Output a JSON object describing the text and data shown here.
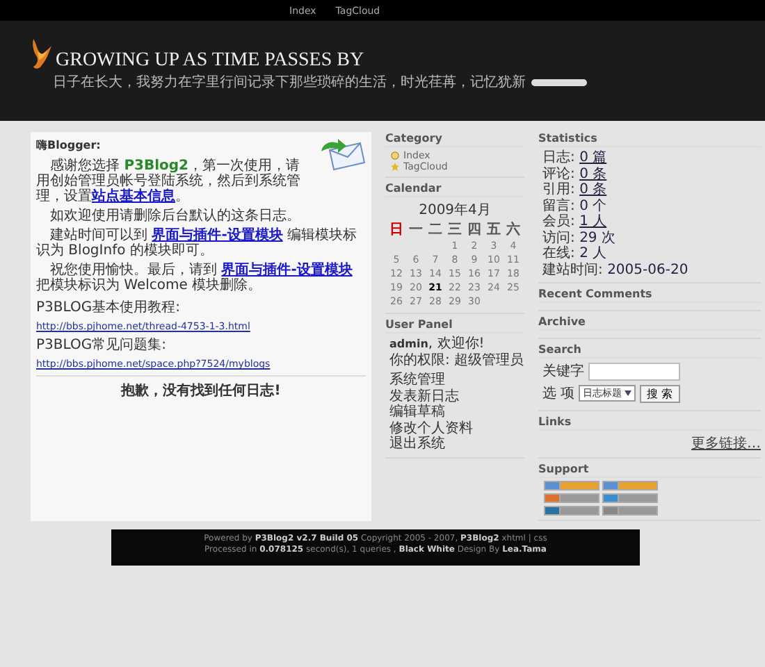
{
  "nav": [
    {
      "label": "Index"
    },
    {
      "label": "TagCloud"
    }
  ],
  "header": {
    "title": "GROWING UP AS TIME PASSES BY",
    "subtitle": "日子在长大，我努力在字里行间记录下那些琐碎的生活，时光荏苒，记忆犹新"
  },
  "welcome": {
    "greeting": "嗨Blogger:",
    "paragraphs": [
      [
        {
          "kind": "text",
          "text": "感谢您选择 "
        },
        {
          "kind": "name",
          "text": "P3Blog2"
        },
        {
          "kind": "text",
          "text": "，第一次使用，请用创始管理员帐号登陆系统，然后到系统管理，设置"
        },
        {
          "kind": "link",
          "text": "站点基本信息"
        },
        {
          "kind": "text",
          "text": "。"
        }
      ],
      [
        {
          "kind": "text",
          "text": "如欢迎使用请删除后台默认的这条日志。"
        }
      ],
      [
        {
          "kind": "text",
          "text": "建站时间可以到 "
        },
        {
          "kind": "link",
          "text": "界面与插件-设置模块"
        },
        {
          "kind": "text",
          "text": " 编辑模块标识为 BlogInfo 的模块即可。"
        }
      ],
      [
        {
          "kind": "text",
          "text": "祝您使用愉快。最后，请到 "
        },
        {
          "kind": "link",
          "text": "界面与插件-设置模块"
        },
        {
          "kind": "text",
          "text": " 把模块标识为 Welcome 模块删除。"
        }
      ]
    ],
    "resources": [
      {
        "label": "P3BLOG基本使用教程:",
        "url": "http://bbs.pjhome.net/thread-4753-1-3.html"
      },
      {
        "label": "P3BLOG常见问题集:",
        "url": "http://bbs.pjhome.net/space.php?7524/myblogs"
      }
    ]
  },
  "notice": "抱歉，没有找到任何日志!",
  "sidebar": [
    {
      "kind": "category",
      "title": "Category",
      "items": [
        "Index",
        "TagCloud"
      ]
    },
    {
      "kind": "calendar",
      "title": "Calendar",
      "month": "2009年4月",
      "weekdays": [
        {
          "label": "日",
          "color": "#cc0000"
        },
        {
          "label": "一",
          "color": "#555555"
        },
        {
          "label": "二",
          "color": "#555555"
        },
        {
          "label": "三",
          "color": "#555555"
        },
        {
          "label": "四",
          "color": "#555555"
        },
        {
          "label": "五",
          "color": "#555555"
        },
        {
          "label": "六",
          "color": "#555555"
        }
      ],
      "weeks": [
        {
          "kind": "tail",
          "days": [
            {
              "day": "1",
              "today": false
            },
            {
              "day": "2",
              "today": false
            },
            {
              "day": "3",
              "today": false
            },
            {
              "day": "4",
              "today": false
            }
          ]
        },
        {
          "kind": "row",
          "days": [
            {
              "day": "5",
              "today": false
            },
            {
              "day": "6",
              "today": false
            },
            {
              "day": "7",
              "today": false
            },
            {
              "day": "8",
              "today": false
            },
            {
              "day": "9",
              "today": false
            },
            {
              "day": "10",
              "today": false
            },
            {
              "day": "11",
              "today": false
            }
          ]
        },
        {
          "kind": "row",
          "days": [
            {
              "day": "12",
              "today": false
            },
            {
              "day": "13",
              "today": false
            },
            {
              "day": "14",
              "today": false
            },
            {
              "day": "15",
              "today": false
            },
            {
              "day": "16",
              "today": false
            },
            {
              "day": "17",
              "today": false
            },
            {
              "day": "18",
              "today": false
            }
          ]
        },
        {
          "kind": "row",
          "days": [
            {
              "day": "19",
              "today": false
            },
            {
              "day": "20",
              "today": false
            },
            {
              "day": "21",
              "today": true
            },
            {
              "day": "22",
              "today": false
            },
            {
              "day": "23",
              "today": false
            },
            {
              "day": "24",
              "today": false
            },
            {
              "day": "25",
              "today": false
            }
          ]
        },
        {
          "kind": "row",
          "days": [
            {
              "day": "26",
              "today": false
            },
            {
              "day": "27",
              "today": false
            },
            {
              "day": "28",
              "today": false
            },
            {
              "day": "29",
              "today": false
            },
            {
              "day": "30",
              "today": false
            }
          ]
        }
      ]
    },
    {
      "kind": "user",
      "title": "User Panel",
      "user": "admin",
      "greeting": ", 欢迎你!",
      "role": "你的权限: 超级管理员",
      "links": [
        "系统管理",
        "发表新日志",
        "编辑草稿",
        "修改个人资料",
        "退出系统"
      ]
    },
    {
      "kind": "stats",
      "title": "Statistics",
      "rows": [
        {
          "label": "日志:",
          "value": "0 篇",
          "link": true
        },
        {
          "label": "评论:",
          "value": "0 条",
          "link": true
        },
        {
          "label": "引用:",
          "value": "0 条",
          "link": true
        },
        {
          "label": "留言:",
          "value": "0 个",
          "link": false
        },
        {
          "label": "会员:",
          "value": "1 人",
          "link": true
        },
        {
          "label": "访问:",
          "value": "29 次",
          "link": false
        },
        {
          "label": "在线:",
          "value": "2 人",
          "link": false
        },
        {
          "label": "建站时间:",
          "value": "2005-06-20",
          "link": false
        }
      ]
    },
    {
      "kind": "empty",
      "title": "Recent Comments"
    },
    {
      "kind": "empty",
      "title": "Archive"
    },
    {
      "kind": "search",
      "title": "Search",
      "keyword_label": "关键字",
      "option_label": "选 项",
      "option": "日志标题",
      "button": "搜 索"
    },
    {
      "kind": "links",
      "title": "Links",
      "more": "更多链接…"
    },
    {
      "kind": "support",
      "title": "Support"
    }
  ],
  "footer": {
    "line1": "Powered by **P3Blog2 v2.7 Build 05** Copyright 2005 - 2007, **P3Blog2** xhtml | css",
    "line2": "Processed in **0.078125** second(s), 1 queries , **Black White** Design By **Lea.Tama**"
  }
}
